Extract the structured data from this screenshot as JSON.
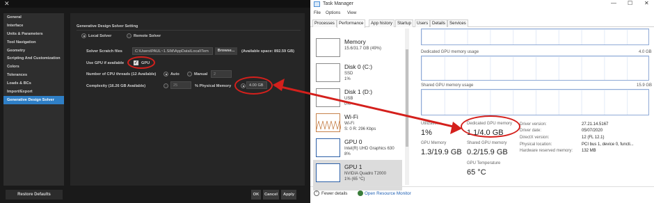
{
  "left_dialog": {
    "close_glyph": "✕",
    "nav_items": [
      "General",
      "Interface",
      "Units & Parameters",
      "Tool Navigation",
      "Geometry",
      "Scripting And Customization",
      "Colors",
      "Tolerances",
      "Loads & BCs",
      "Import/Export",
      "Generative Design Solver"
    ],
    "section_title": "Generative Design Solver Setting",
    "local_solver": "Local Solver",
    "remote_solver": "Remote Solver",
    "scratch_label": "Solver Scratch files",
    "scratch_path": "C:\\Users\\PAUL~1.SIM\\AppData\\Local\\Tem",
    "browse": "Browse...",
    "available_space": "(Available space: 892.59 GB)",
    "use_gpu_label": "Use GPU if available",
    "gpu": "GPU",
    "cpu_threads_label": "Number of CPU threads (12 Available)",
    "auto": "Auto",
    "manual": "Manual",
    "manual_value": "2",
    "complexity_label": "Complexity (16.26 GB Available)",
    "complexity_value": "25",
    "physical_memory": "% Physical Memory",
    "memory_gb": "4.00 GB",
    "restore_defaults": "Restore Defaults",
    "ok": "OK",
    "cancel": "Cancel",
    "apply": "Apply"
  },
  "task_manager": {
    "title": "Task Manager",
    "menu": [
      "File",
      "Options",
      "View"
    ],
    "tabs": [
      "Processes",
      "Performance",
      "App history",
      "Startup",
      "Users",
      "Details",
      "Services"
    ],
    "resources": [
      {
        "name": "Memory",
        "sub1": "15.6/31.7 GB (49%)",
        "sub2": ""
      },
      {
        "name": "Disk 0 (C:)",
        "sub1": "SSD",
        "sub2": "1%"
      },
      {
        "name": "Disk 1 (D:)",
        "sub1": "USB",
        "sub2": "0%"
      },
      {
        "name": "Wi-Fi",
        "sub1": "Wi-Fi",
        "sub2": "S: 0  R: 296 Kbps"
      },
      {
        "name": "GPU 0",
        "sub1": "Intel(R) UHD Graphics 630",
        "sub2": "8%"
      },
      {
        "name": "GPU 1",
        "sub1": "NVIDIA Quadro T2000",
        "sub2": "1% (65 °C)"
      }
    ],
    "dedicated_usage_label": "Dedicated GPU memory usage",
    "dedicated_usage_max": "4.0 GB",
    "shared_usage_label": "Shared GPU memory usage",
    "shared_usage_max": "15.9 GB",
    "utilization_label": "Utilization",
    "utilization": "1%",
    "dedicated_label": "Dedicated GPU memory",
    "dedicated_value": "1.1/4.0 GB",
    "gpu_memory_label": "GPU Memory",
    "gpu_memory_value": "1.3/19.9 GB",
    "shared_label": "Shared GPU memory",
    "shared_value": "0.2/15.9 GB",
    "temp_label": "GPU Temperature",
    "temp_value": "65 °C",
    "details": [
      {
        "k": "Driver version:",
        "v": "27.21.14.5167"
      },
      {
        "k": "Driver date:",
        "v": "05/07/2020"
      },
      {
        "k": "DirectX version:",
        "v": "12 (FL 12.1)"
      },
      {
        "k": "Physical location:",
        "v": "PCI bus 1, device 0, functi..."
      },
      {
        "k": "Hardware reserved memory:",
        "v": "132 MB"
      }
    ],
    "fewer_details": "Fewer details",
    "open_resource_monitor": "Open Resource Monitor"
  },
  "annotation_color": "#d4201c"
}
